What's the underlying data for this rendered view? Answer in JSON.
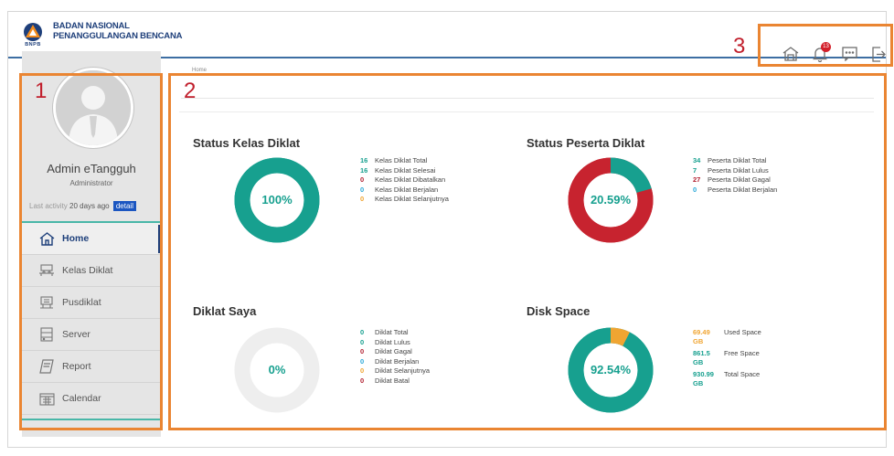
{
  "header": {
    "org_line1": "BADAN NASIONAL",
    "org_line2": "PENANGGULANGAN BENCANA",
    "logo_abbr": "BNPB",
    "notification_count": "13",
    "icons": [
      "dashboard-home-icon",
      "bell-icon",
      "message-icon",
      "logout-icon"
    ]
  },
  "sidebar": {
    "user_name": "Admin eTangguh",
    "user_role": "Administrator",
    "last_activity_label": "Last activity",
    "last_activity_value": "20 days ago",
    "detail_label": "detail",
    "menu": [
      {
        "label": "Home",
        "icon": "home-icon",
        "active": true
      },
      {
        "label": "Kelas Diklat",
        "icon": "classroom-icon",
        "active": false
      },
      {
        "label": "Pusdiklat",
        "icon": "building-icon",
        "active": false
      },
      {
        "label": "Server",
        "icon": "server-icon",
        "active": false
      },
      {
        "label": "Report",
        "icon": "report-icon",
        "active": false
      },
      {
        "label": "Calendar",
        "icon": "calendar-icon",
        "active": false
      }
    ]
  },
  "breadcrumb": "Home",
  "panels": {
    "kelas": {
      "title": "Status Kelas Diklat",
      "percent": "100%",
      "stats": [
        {
          "value": "16",
          "label": "Kelas Diklat Total",
          "color": "#17a08f"
        },
        {
          "value": "16",
          "label": "Kelas Diklat Selesai",
          "color": "#17a08f"
        },
        {
          "value": "0",
          "label": "Kelas Diklat Dibatalkan",
          "color": "#b22030"
        },
        {
          "value": "0",
          "label": "Kelas Diklat Berjalan",
          "color": "#29a8d8"
        },
        {
          "value": "0",
          "label": "Kelas Diklat Selanjutnya",
          "color": "#f0a532"
        }
      ]
    },
    "peserta": {
      "title": "Status Peserta Diklat",
      "percent": "20.59%",
      "stats": [
        {
          "value": "34",
          "label": "Peserta Diklat Total",
          "color": "#17a08f"
        },
        {
          "value": "7",
          "label": "Peserta Diklat Lulus",
          "color": "#17a08f"
        },
        {
          "value": "27",
          "label": "Peserta Diklat Gagal",
          "color": "#b22030"
        },
        {
          "value": "0",
          "label": "Peserta Diklat Berjalan",
          "color": "#29a8d8"
        }
      ]
    },
    "saya": {
      "title": "Diklat Saya",
      "percent": "0%",
      "stats": [
        {
          "value": "0",
          "label": "Diklat Total",
          "color": "#17a08f"
        },
        {
          "value": "0",
          "label": "Diklat Lulus",
          "color": "#17a08f"
        },
        {
          "value": "0",
          "label": "Diklat Gagal",
          "color": "#b22030"
        },
        {
          "value": "0",
          "label": "Diklat Berjalan",
          "color": "#29a8d8"
        },
        {
          "value": "0",
          "label": "Diklat Selanjutnya",
          "color": "#f0a532"
        },
        {
          "value": "0",
          "label": "Diklat Batal",
          "color": "#b22030"
        }
      ]
    },
    "disk": {
      "title": "Disk Space",
      "percent": "92.54%",
      "stats": [
        {
          "value": "69.49",
          "unit": "GB",
          "label": "Used Space",
          "color": "#f0a532"
        },
        {
          "value": "861.5",
          "unit": "GB",
          "label": "Free Space",
          "color": "#17a08f"
        },
        {
          "value": "930.99",
          "unit": "GB",
          "label": "Total Space",
          "color": "#17a08f"
        }
      ]
    }
  },
  "donut_values": {
    "kelas": {
      "segments": [
        {
          "fraction": 1.0,
          "color": "#17a08f"
        }
      ],
      "track": "#17a08f"
    },
    "peserta": {
      "segments": [
        {
          "fraction": 0.2059,
          "color": "#17a08f"
        },
        {
          "fraction": 0.7941,
          "color": "#c7232f"
        }
      ],
      "track": "#c7232f"
    },
    "saya": {
      "segments": [],
      "track": "#eeeeee"
    },
    "disk": {
      "segments": [
        {
          "fraction": 0.0746,
          "color": "#f0a532"
        },
        {
          "fraction": 0.9254,
          "color": "#17a08f"
        }
      ],
      "track": "#17a08f"
    }
  },
  "annotations": {
    "sidebar_num": "1",
    "content_num": "2",
    "header_num": "3",
    "color": "#ea8532"
  }
}
